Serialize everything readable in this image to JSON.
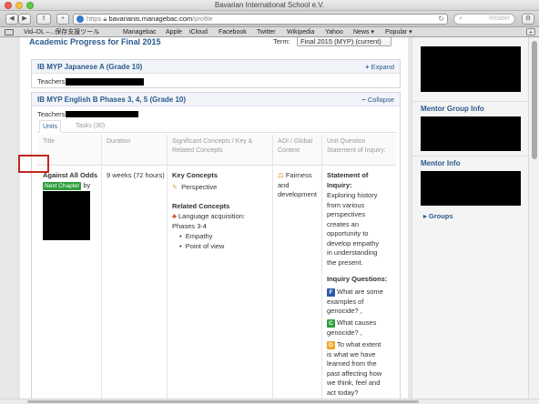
{
  "window": {
    "title": "Bavarian International School e.V."
  },
  "toolbar": {
    "url_protocol": "https",
    "url_host": "bavarianis.managebac.com",
    "url_path": "/profile",
    "reader_label": "Reader"
  },
  "bookmarks": [
    "Vid–DL –...保存支援ツール",
    "Managebac",
    "Apple",
    "iCloud",
    "Facebook",
    "Twitter",
    "Wikipedia",
    "Yahoo",
    "News ▾",
    "Popular ▾"
  ],
  "main": {
    "heading": "Academic Progress for Final 2015",
    "term_label": "Term:",
    "term_value": "Final 2015 (MYP) (current)",
    "courses": [
      {
        "title": "IB MYP Japanese A (Grade 10)",
        "action": "Expand",
        "teachers_label": "Teachers:"
      },
      {
        "title": "IB MYP English B Phases 3, 4, 5 (Grade 10)",
        "action": "Collapse",
        "teachers_label": "Teachers:"
      }
    ],
    "tabs": [
      {
        "label": "Units"
      },
      {
        "label": "Tasks (30)"
      }
    ],
    "table": {
      "headers": [
        "Title",
        "Duration",
        "Significant Concepts / Key & Related Concepts",
        "AOI / Global Context",
        "Unit Question Statement of Inquiry:"
      ],
      "row": {
        "title": "Against All Odds",
        "badge": "Next Chapter",
        "by": "by",
        "duration": "9 weeks (72 hours)",
        "key_concepts_label": "Key Concepts",
        "key_concept": "Perspective",
        "related_concepts_label": "Related Concepts",
        "related_concept": "Language acquisition: Phases 3-4",
        "related_items": [
          "Empathy",
          "Point of view"
        ],
        "global_context": "Fairness and development",
        "statement_label": "Statement of Inquiry:",
        "statement": "Exploring history from various perspectives creates an opportunity to develop empathy in understanding the present.",
        "questions_label": "Inquiry Questions:",
        "questions": [
          {
            "type": "F",
            "text": "What are some examples of genocide? ,"
          },
          {
            "type": "C",
            "text": "What causes genocide? ,"
          },
          {
            "type": "D",
            "text": "To what extent is what we have learned from the past affecting how we think, feel and act today?"
          }
        ]
      }
    }
  },
  "sidebar": {
    "mentor_group_label": "Mentor Group Info",
    "mentor_info_label": "Mentor Info",
    "groups_label": "Groups"
  }
}
